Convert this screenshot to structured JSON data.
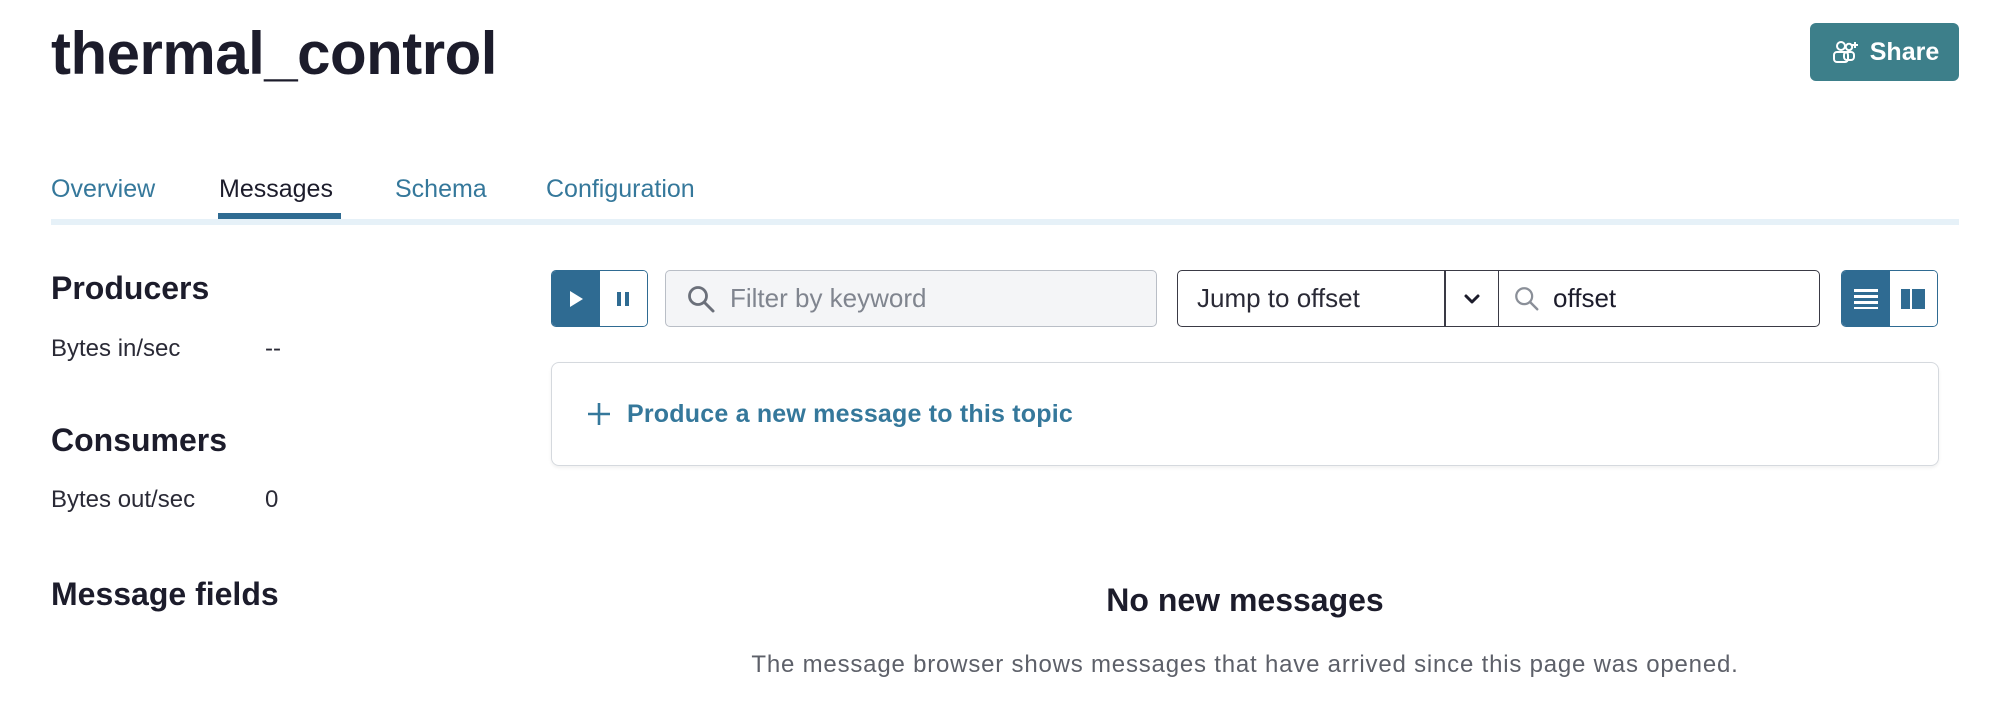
{
  "header": {
    "title": "thermal_control",
    "share_label": "Share"
  },
  "tabs": [
    {
      "label": "Overview",
      "active": false
    },
    {
      "label": "Messages",
      "active": true
    },
    {
      "label": "Schema",
      "active": false
    },
    {
      "label": "Configuration",
      "active": false
    }
  ],
  "sidebar": {
    "producers": {
      "title": "Producers",
      "metric_label": "Bytes in/sec",
      "metric_value": "--"
    },
    "consumers": {
      "title": "Consumers",
      "metric_label": "Bytes out/sec",
      "metric_value": "0"
    },
    "message_fields": {
      "title": "Message fields"
    }
  },
  "toolbar": {
    "filter_placeholder": "Filter by keyword",
    "jump_label": "Jump to offset",
    "offset_value": "offset"
  },
  "produce": {
    "label": "Produce a new message to this topic"
  },
  "empty_state": {
    "title": "No new messages",
    "description": "The message browser shows messages that have arrived since this page was opened."
  },
  "icons": {
    "share": "share-users-icon",
    "play": "play-icon",
    "pause": "pause-icon",
    "search": "search-icon",
    "chevron": "chevron-down-icon",
    "list_view": "list-view-icon",
    "split_view": "split-view-icon",
    "plus": "plus-icon"
  },
  "colors": {
    "accent": "#2f6b92",
    "share_bg": "#3d7f8a",
    "link": "#35789b"
  }
}
